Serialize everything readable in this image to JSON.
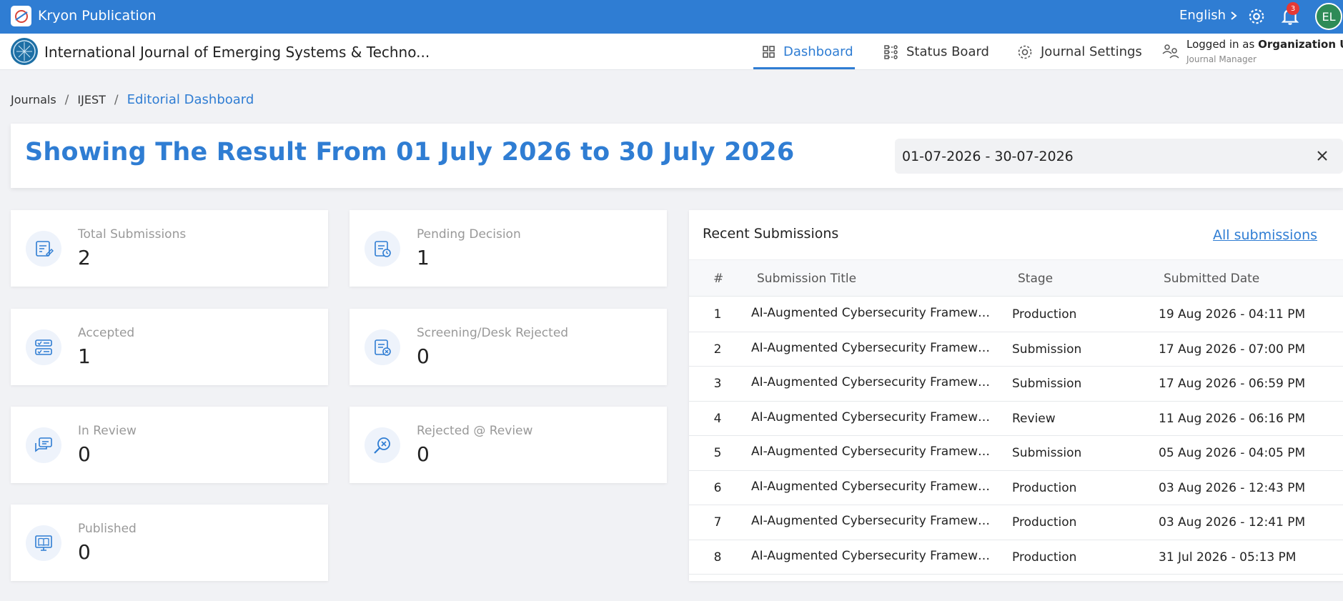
{
  "topbar": {
    "app_name": "Kryon Publication",
    "language": "English",
    "notification_count": "3",
    "user_initials": "EL",
    "accent_color": "#2f7dd3"
  },
  "navbar": {
    "journal_title": "International Journal of Emerging Systems & Techno...",
    "items": [
      {
        "label": "Dashboard",
        "icon": "grid-icon",
        "active": true
      },
      {
        "label": "Status Board",
        "icon": "workflow-icon",
        "active": false
      },
      {
        "label": "Journal Settings",
        "icon": "gear-icon",
        "active": false
      }
    ],
    "logged_in_prefix": "Logged in as",
    "logged_in_user": "Organization User",
    "role": "Journal Manager"
  },
  "breadcrumb": {
    "items": [
      "Journals",
      "IJEST",
      "Editorial Dashboard"
    ]
  },
  "result": {
    "title": "Showing The Result From 01 July 2026 to 30 July 2026",
    "date_range": "01-07-2026 - 30-07-2026"
  },
  "stats": [
    {
      "label": "Total Submissions",
      "value": "2",
      "icon": "edit-document-icon"
    },
    {
      "label": "Pending Decision",
      "value": "1",
      "icon": "document-clock-icon"
    },
    {
      "label": "Accepted",
      "value": "1",
      "icon": "checklist-icon"
    },
    {
      "label": "Screening/Desk Rejected",
      "value": "0",
      "icon": "document-reject-icon"
    },
    {
      "label": "In Review",
      "value": "0",
      "icon": "chat-icon"
    },
    {
      "label": "Rejected @ Review",
      "value": "0",
      "icon": "search-reject-icon"
    },
    {
      "label": "Published",
      "value": "0",
      "icon": "book-monitor-icon"
    }
  ],
  "recent": {
    "title": "Recent Submissions",
    "all_link": "All submissions",
    "columns": [
      "#",
      "Submission Title",
      "Stage",
      "Submitted Date"
    ],
    "rows": [
      {
        "num": "1",
        "title": "AI-Augmented Cybersecurity Framework for Critical Infrastructure",
        "stage": "Production",
        "date": "19 Aug 2026 - 04:11 PM"
      },
      {
        "num": "2",
        "title": "AI-Augmented Cybersecurity Framework for Critical Infrastructure",
        "stage": "Submission",
        "date": "17 Aug 2026 - 07:00 PM"
      },
      {
        "num": "3",
        "title": "AI-Augmented Cybersecurity Framework for Critical Infrastructure",
        "stage": "Submission",
        "date": "17 Aug 2026 - 06:59 PM"
      },
      {
        "num": "4",
        "title": "AI-Augmented Cybersecurity Framework for Critical Infrastructure",
        "stage": "Review",
        "date": "11 Aug 2026 - 06:16 PM"
      },
      {
        "num": "5",
        "title": "AI-Augmented Cybersecurity Framework for Critical Infrastructure",
        "stage": "Submission",
        "date": "05 Aug 2026 - 04:05 PM"
      },
      {
        "num": "6",
        "title": "AI-Augmented Cybersecurity Framework for Critical Infrastructure",
        "stage": "Production",
        "date": "03 Aug 2026 - 12:43 PM"
      },
      {
        "num": "7",
        "title": "AI-Augmented Cybersecurity Framework for Critical Infrastructure",
        "stage": "Production",
        "date": "03 Aug 2026 - 12:41 PM"
      },
      {
        "num": "8",
        "title": "AI-Augmented Cybersecurity Framework for Critical Infrastructure",
        "stage": "Production",
        "date": "31 Jul 2026 - 05:13 PM"
      }
    ]
  }
}
